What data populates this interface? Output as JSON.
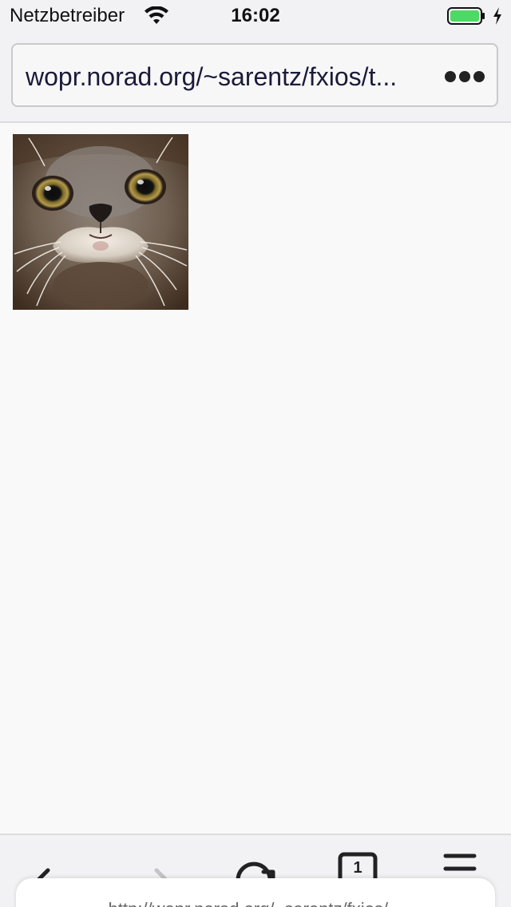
{
  "status_bar": {
    "carrier": "Netzbetreiber",
    "time": "16:02",
    "battery_level_percent": 100,
    "battery_color": "#4cd964"
  },
  "url_bar": {
    "url": "wopr.norad.org/~sarentz/fxios/t..."
  },
  "content": {
    "image_icon": "cat-photo"
  },
  "toolbar": {
    "tab_count": "1",
    "back_icon": "arrow-left-icon",
    "forward_icon": "arrow-right-icon",
    "reload_icon": "reload-icon",
    "menu_icon": "hamburger-menu-icon"
  },
  "toast": {
    "text": "http://wopr.norad.org/~sarentz/fxios/..."
  }
}
